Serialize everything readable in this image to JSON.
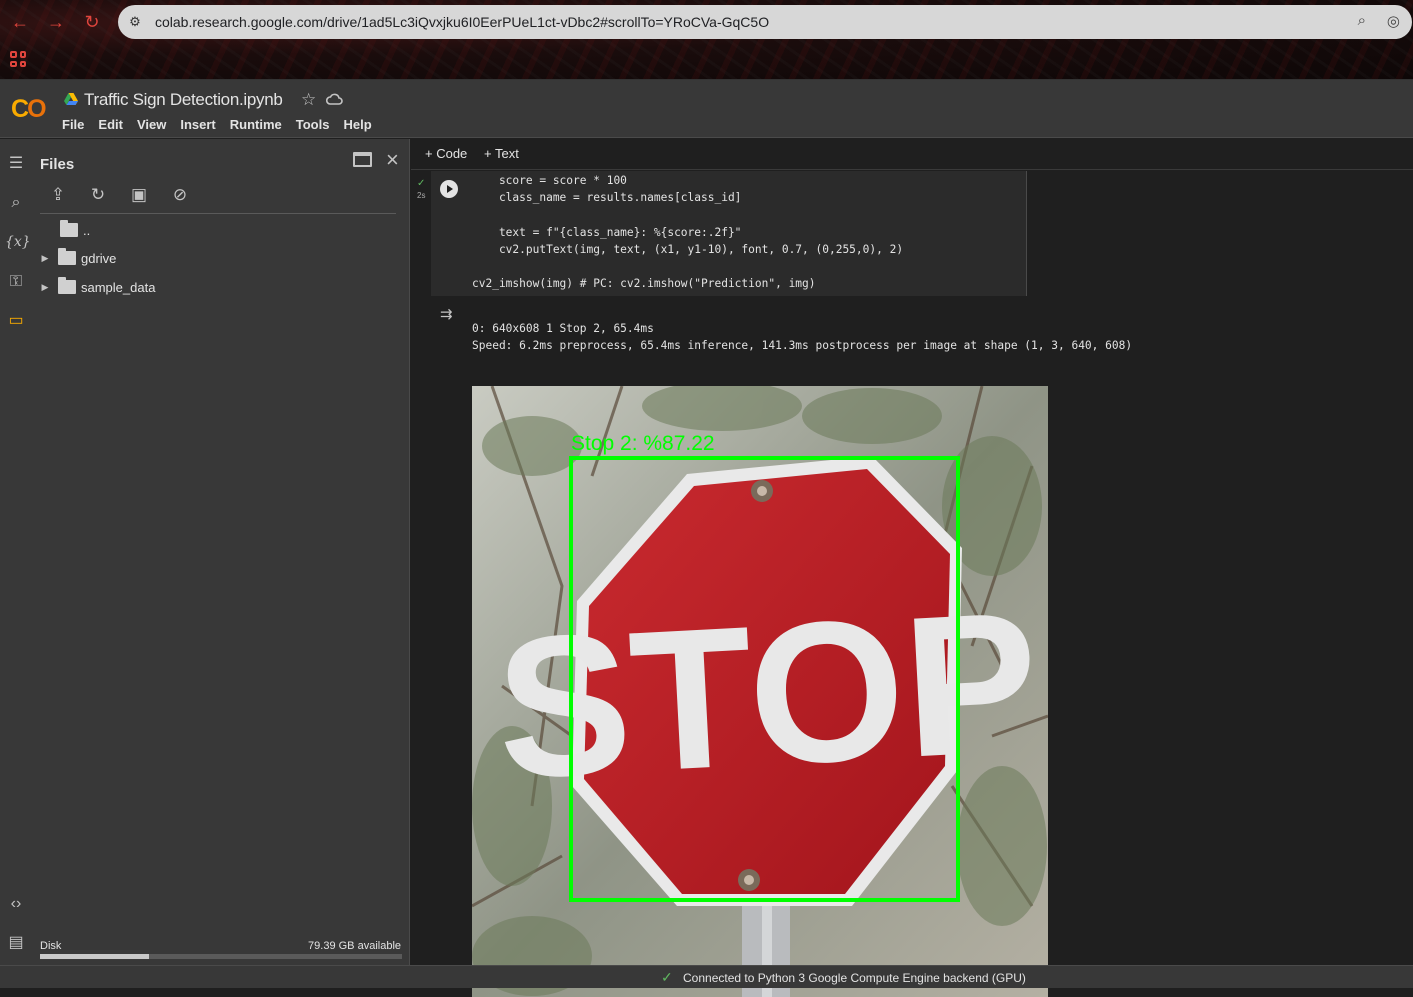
{
  "browser": {
    "url": "colab.research.google.com/drive/1ad5Lc3iQvxjku6I0EerPUeL1ct-vDbc2#scrollTo=YRoCVa-GqC5O",
    "accent_color": "#e0453d"
  },
  "header": {
    "logo_text": "CO",
    "notebook_title": "Traffic Sign Detection.ipynb",
    "menu": [
      "File",
      "Edit",
      "View",
      "Insert",
      "Runtime",
      "Tools",
      "Help"
    ]
  },
  "sidebar": {
    "rail_icons": [
      "toc-icon",
      "search-icon",
      "variables-icon",
      "key-icon",
      "folder-icon",
      "code-snippets-icon",
      "terminal-icon"
    ]
  },
  "files": {
    "title": "Files",
    "tree": [
      {
        "name": "..",
        "expandable": false
      },
      {
        "name": "gdrive",
        "expandable": true
      },
      {
        "name": "sample_data",
        "expandable": true
      }
    ],
    "disk_label": "Disk",
    "disk_available": "79.39 GB available",
    "disk_used_fraction": 0.3
  },
  "toolbar": {
    "add_code": "+ Code",
    "add_text": "+ Text"
  },
  "cell": {
    "status": "✓",
    "exec_time": "2s",
    "code_lines": [
      "    score = score * 100",
      "    class_name = results.names[class_id]",
      "",
      "    text = f\"{class_name}: %{score:.2f}\"",
      "    cv2.putText(img, text, (x1, y1-10), font, 0.7, (0,255,0), 2)",
      "",
      "cv2_imshow(img) # PC: cv2.imshow(\"Prediction\", img)"
    ],
    "output_lines": [
      "0: 640x608 1 Stop 2, 65.4ms",
      "Speed: 6.2ms preprocess, 65.4ms inference, 141.3ms postprocess per image at shape (1, 3, 640, 608)"
    ]
  },
  "image": {
    "sign_text": "STOP",
    "detection_label": "Stop 2: %87.22",
    "box_color": "#00ff00"
  },
  "status_bar": {
    "text": "Connected to Python 3 Google Compute Engine backend (GPU)"
  }
}
